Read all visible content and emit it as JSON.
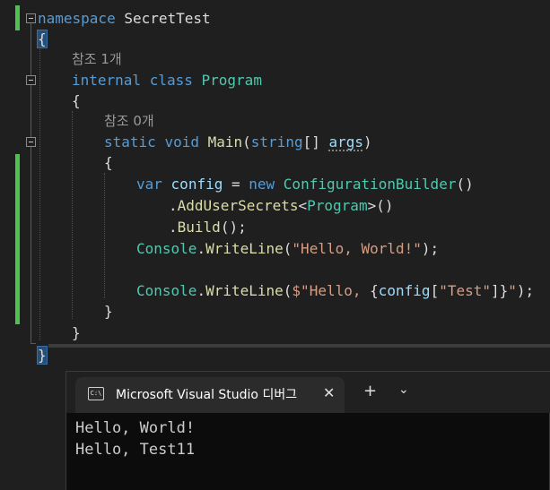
{
  "editor": {
    "namespace_keyword": "namespace",
    "namespace_name": "SecretTest",
    "open_brace": "{",
    "close_brace": "}",
    "class_ref_count": "참조 1개",
    "class_modifier": "internal",
    "class_keyword": "class",
    "class_name": "Program",
    "method_ref_count": "참조 0개",
    "method_static": "static",
    "method_void": "void",
    "method_name": "Main",
    "method_param_type": "string",
    "method_param_brackets": "[]",
    "method_param_name": "args",
    "line_var_keyword": "var",
    "line_var_name": "config",
    "line_var_eq": " = ",
    "line_new_keyword": "new",
    "line_builder_type": "ConfigurationBuilder",
    "line_builder_parens": "()",
    "line_add_secrets_method": "AddUserSecrets",
    "line_add_secrets_generic_open": "<",
    "line_add_secrets_generic_type": "Program",
    "line_add_secrets_generic_close": ">()",
    "line_build_method": "Build",
    "line_build_end": "();",
    "console_type": "Console",
    "writeline_method": "WriteLine",
    "writeline1_arg": "\"Hello, World!\"",
    "writeline2_interp_prefix": "$\"Hello, ",
    "writeline2_config": "config",
    "writeline2_key": "\"Test\"",
    "writeline2_interp_suffix": "\""
  },
  "terminal": {
    "tab_icon": "C:\\",
    "tab_title": "Microsoft Visual Studio 디버그",
    "tab_close": "✕",
    "new_tab": "+",
    "dropdown": "⌄",
    "output": [
      "Hello, World!",
      "Hello, Test11"
    ]
  },
  "icons": {
    "fold": "collapse-icon",
    "terminal": "console-icon"
  },
  "colors": {
    "keyword": "#569cd6",
    "type": "#4ec9b0",
    "method": "#dcdcaa",
    "variable": "#9cdcfe",
    "string": "#d69d85",
    "change_bar": "#4ec24e"
  }
}
